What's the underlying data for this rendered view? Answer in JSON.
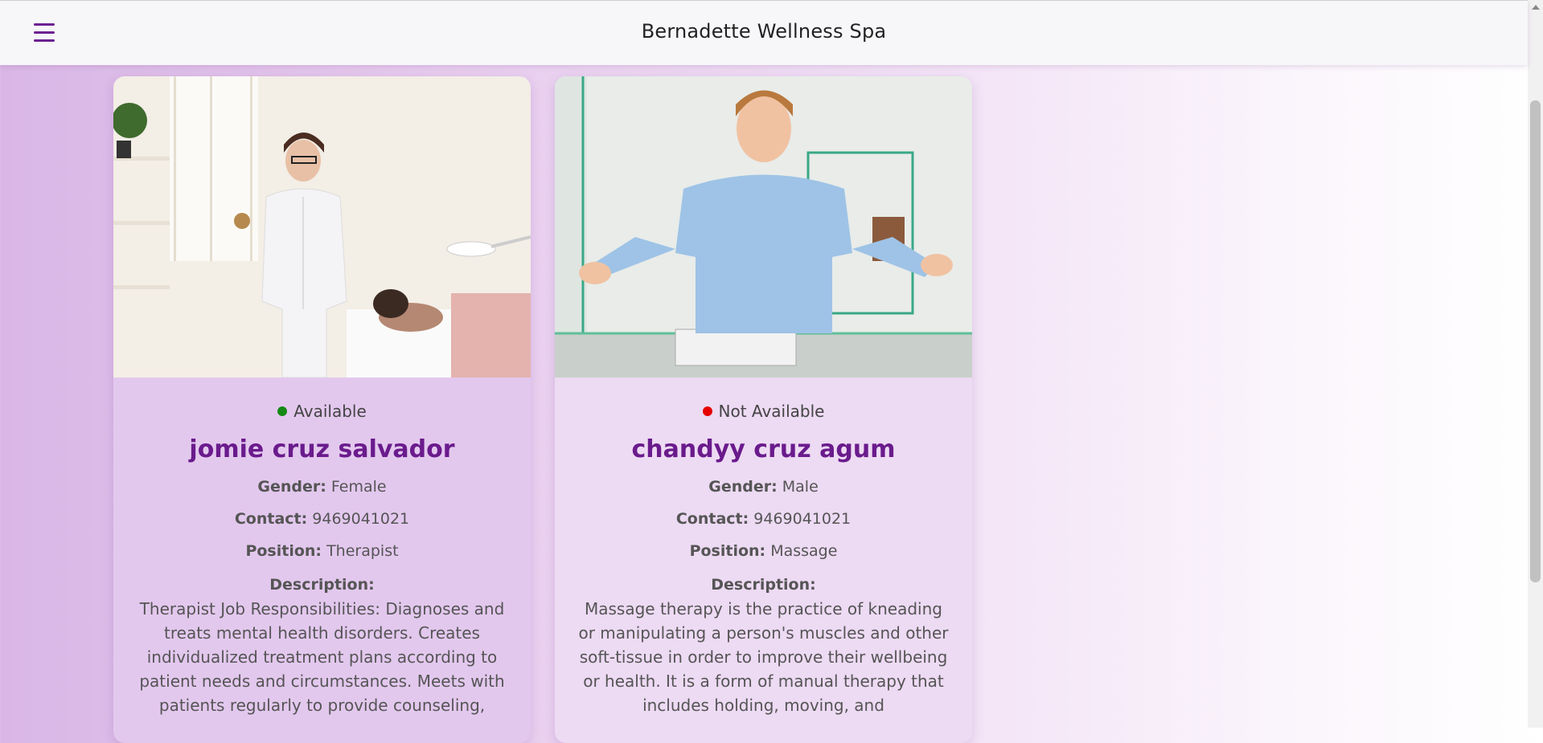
{
  "header": {
    "title": "Bernadette Wellness Spa"
  },
  "icons": {
    "menu": "hamburger-menu-icon"
  },
  "colors": {
    "accent": "#6a1b8c",
    "available": "#148a14",
    "not_available": "#e60000"
  },
  "labels": {
    "gender": "Gender:",
    "contact": "Contact:",
    "position": "Position:",
    "description": "Description:"
  },
  "staff": [
    {
      "status": "Available",
      "name": "jomie cruz salvador",
      "gender": "Female",
      "contact": "9469041021",
      "position": "Therapist",
      "description": "Therapist Job Responsibilities: Diagnoses and treats mental health disorders. Creates individualized treatment plans according to patient needs and circumstances. Meets with patients regularly to provide counseling,"
    },
    {
      "status": "Not Available",
      "name": "chandyy cruz agum",
      "gender": "Male",
      "contact": "9469041021",
      "position": "Massage",
      "description": "Massage therapy is the practice of kneading or manipulating a person's muscles and other soft-tissue in order to improve their wellbeing or health. It is a form of manual therapy that includes holding, moving, and"
    }
  ]
}
